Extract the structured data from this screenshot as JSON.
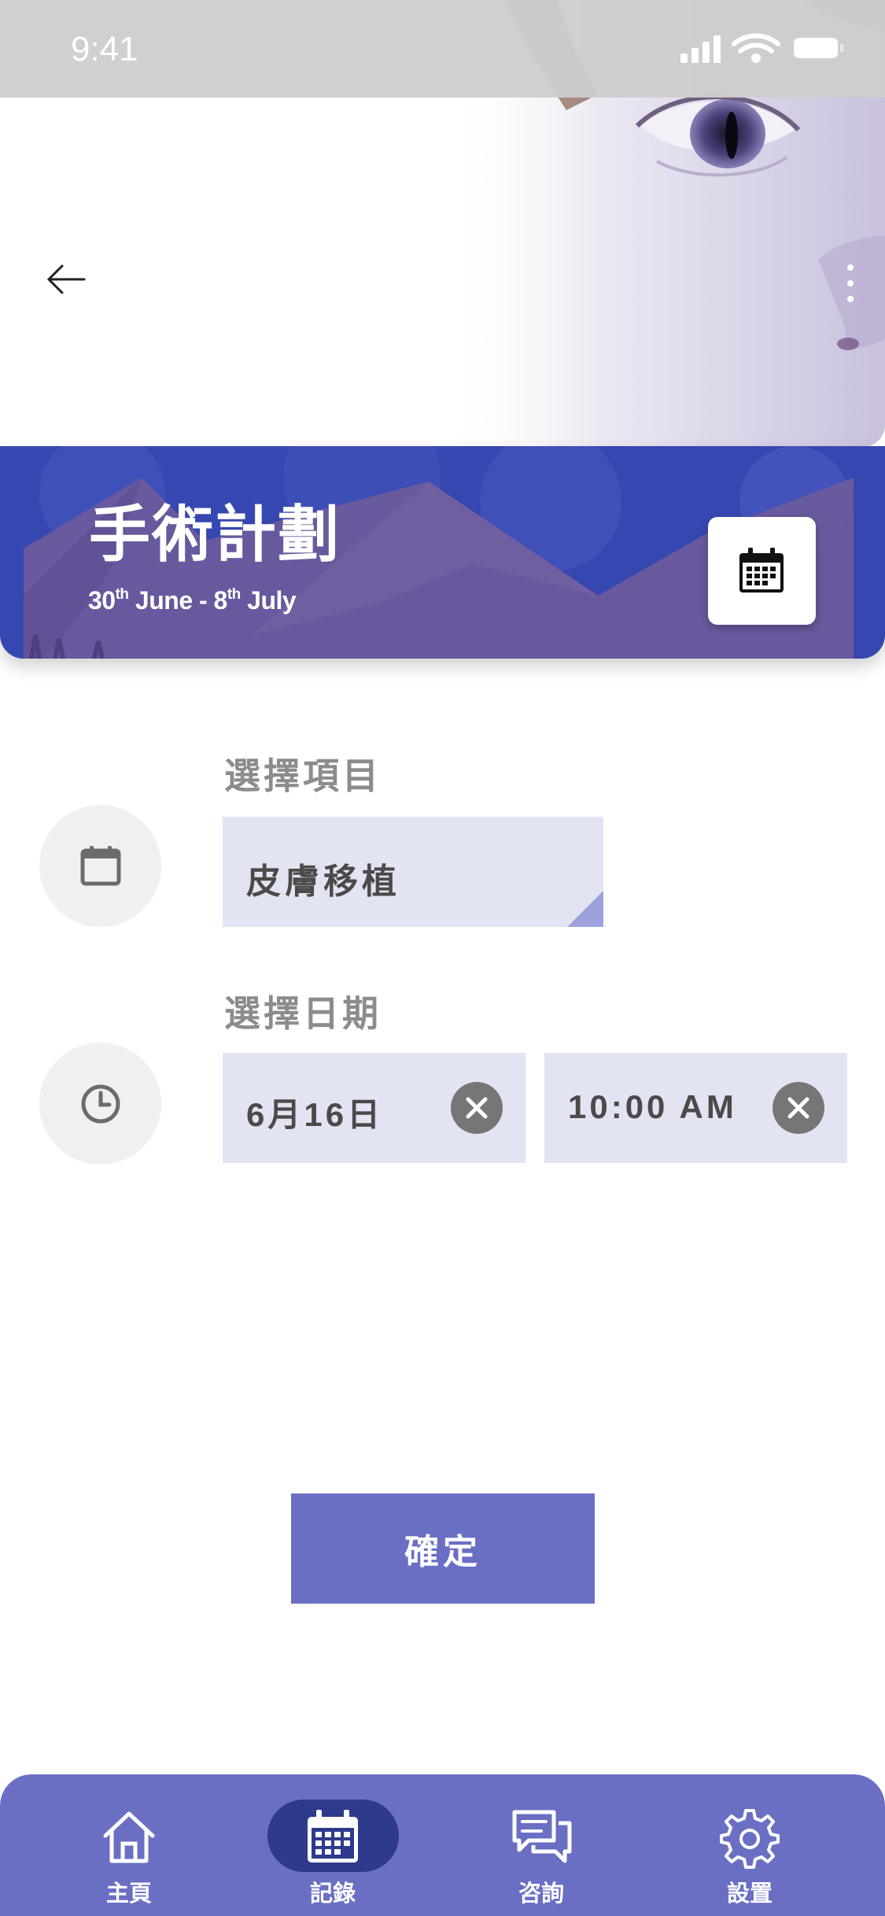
{
  "status_bar": {
    "time": "9:41"
  },
  "plan": {
    "title": "手術計劃",
    "date_start_day": "30",
    "date_start_suffix": "th",
    "date_start_month": "June",
    "date_separator": "-",
    "date_end_day": "8",
    "date_end_suffix": "th",
    "date_end_month": "July"
  },
  "form": {
    "item_label": "選擇項目",
    "item_value": "皮膚移植",
    "date_label": "選擇日期",
    "date_value": "6月16日",
    "time_value": "10:00 AM"
  },
  "confirm_label": "確定",
  "nav": {
    "items": [
      {
        "label": "主頁",
        "icon": "home-icon",
        "active": false
      },
      {
        "label": "記錄",
        "icon": "calendar-icon",
        "active": true
      },
      {
        "label": "咨詢",
        "icon": "chat-icon",
        "active": false
      },
      {
        "label": "設置",
        "icon": "gear-icon",
        "active": false
      }
    ]
  },
  "colors": {
    "primary": "#6a6fc4",
    "banner": "#3647b1",
    "nav_active": "#2e3a8c",
    "field_bg": "#e3e4f3",
    "label_gray": "#8c8c8c"
  }
}
